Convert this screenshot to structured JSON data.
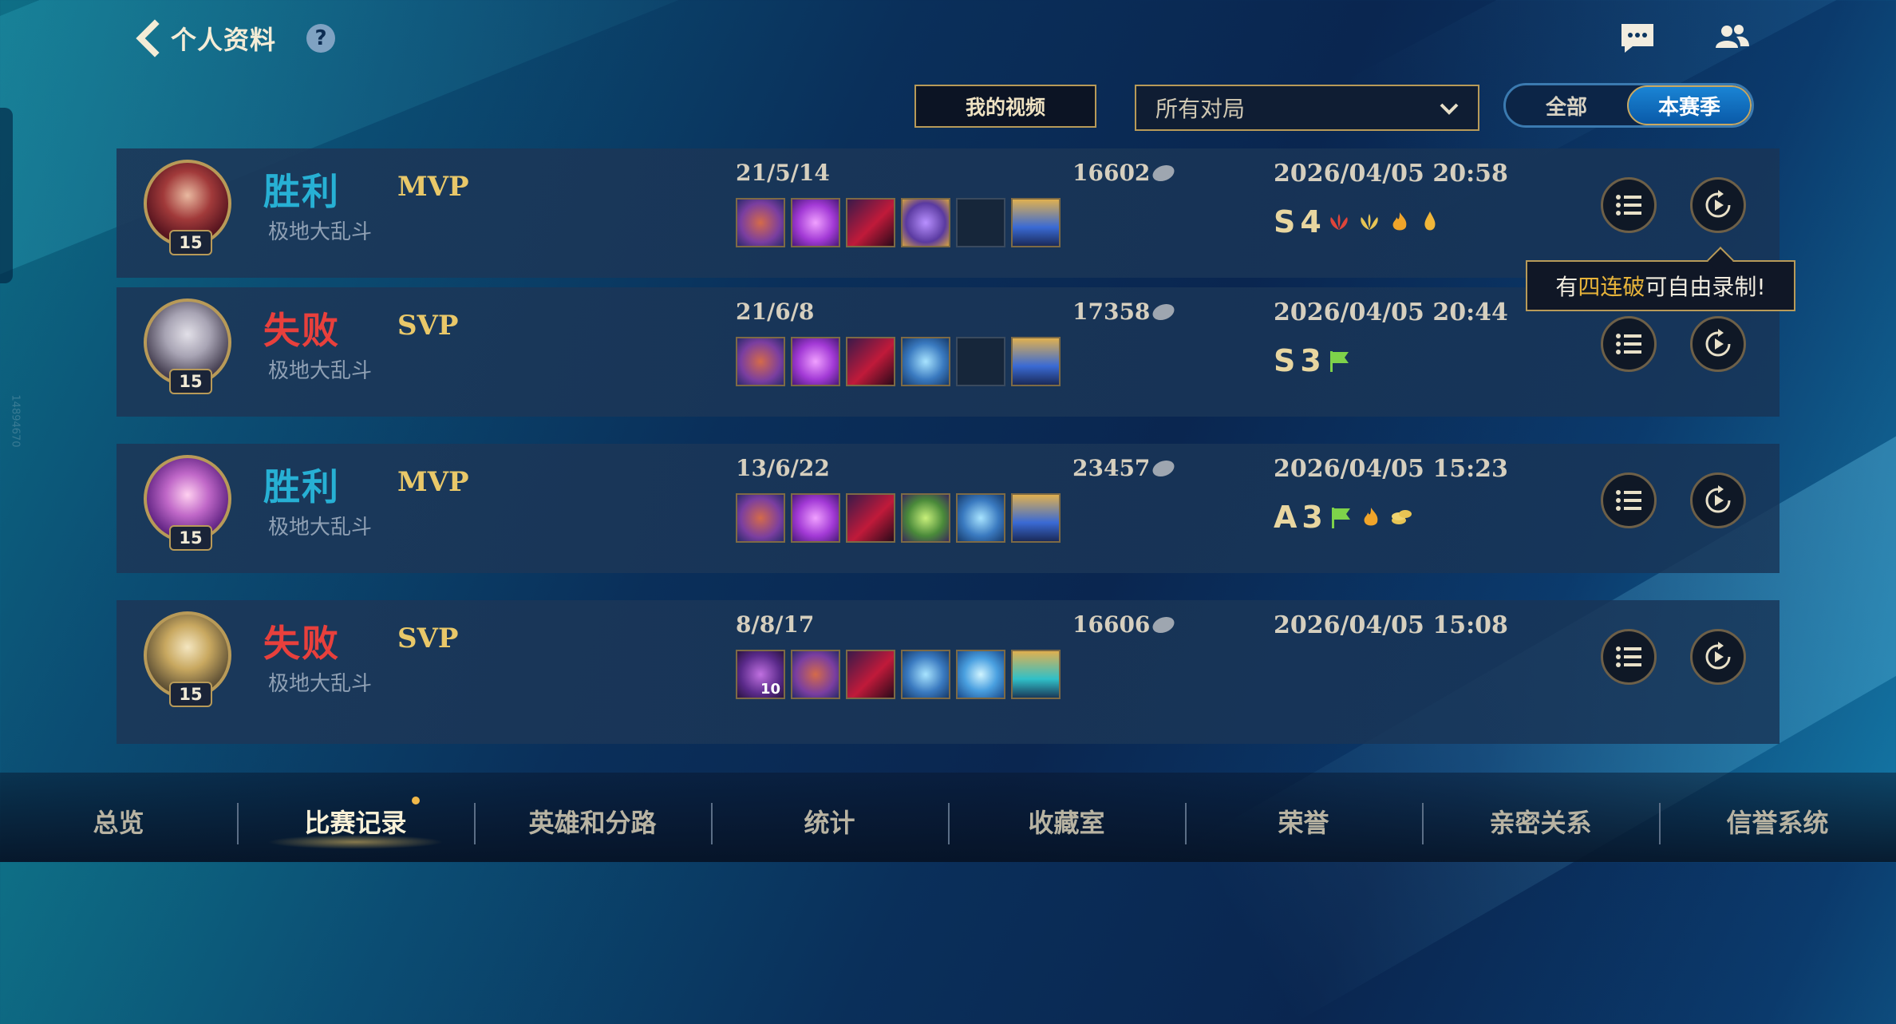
{
  "header": {
    "title": "个人资料"
  },
  "controls": {
    "my_videos": "我的视频",
    "filter_selected": "所有对局",
    "seg_all": "全部",
    "seg_season": "本赛季"
  },
  "matches": [
    {
      "result": "胜利",
      "badge": "MVP",
      "mode": "极地大乱斗",
      "level": "15",
      "kda": "21/5/14",
      "gold": "16602",
      "date": "2026/04/05 20:58",
      "grade": "S",
      "grade_num": "4"
    },
    {
      "result": "失败",
      "badge": "SVP",
      "mode": "极地大乱斗",
      "level": "15",
      "kda": "21/6/8",
      "gold": "17358",
      "date": "2026/04/05 20:44",
      "grade": "S",
      "grade_num": "3"
    },
    {
      "result": "胜利",
      "badge": "MVP",
      "mode": "极地大乱斗",
      "level": "15",
      "kda": "13/6/22",
      "gold": "23457",
      "date": "2026/04/05 15:23",
      "grade": "A",
      "grade_num": "3"
    },
    {
      "result": "失败",
      "badge": "SVP",
      "mode": "极地大乱斗",
      "level": "15",
      "kda": "8/8/17",
      "gold": "16606",
      "date": "2026/04/05 15:08"
    }
  ],
  "tooltip": {
    "pre": "有",
    "highlight": "四连破",
    "post": "可自由录制!"
  },
  "side_id": "14894670",
  "item_badge": "10",
  "nav": [
    "总览",
    "比赛记录",
    "英雄和分路",
    "统计",
    "收藏室",
    "荣誉",
    "亲密关系",
    "信誉系统"
  ],
  "colors": {
    "win": "#27b0d4",
    "lose": "#e8403c",
    "accent": "#b89a58"
  }
}
